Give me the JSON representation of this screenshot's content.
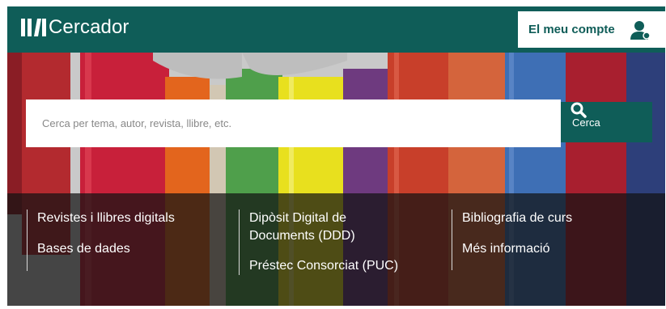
{
  "header": {
    "logo_text": "Cercador",
    "account_label": "El meu compte",
    "account_icon": "user-icon"
  },
  "colors": {
    "brand": "#0f5d58",
    "panel": "rgba(18,18,18,0.72)"
  },
  "search": {
    "placeholder": "Cerca per tema, autor, revista, llibre, etc.",
    "value": "",
    "button_label": "Cerca",
    "button_icon": "search-icon"
  },
  "links": {
    "col1": [
      "Revistes i llibres digitals",
      "Bases de dades"
    ],
    "col2_line1": "Dipòsit Digital de",
    "col2_line2": "Documents (DDD)",
    "col2_item2": "Préstec Consorciat (PUC)",
    "col3": [
      "Bibliografia de curs",
      "Més informació"
    ]
  }
}
